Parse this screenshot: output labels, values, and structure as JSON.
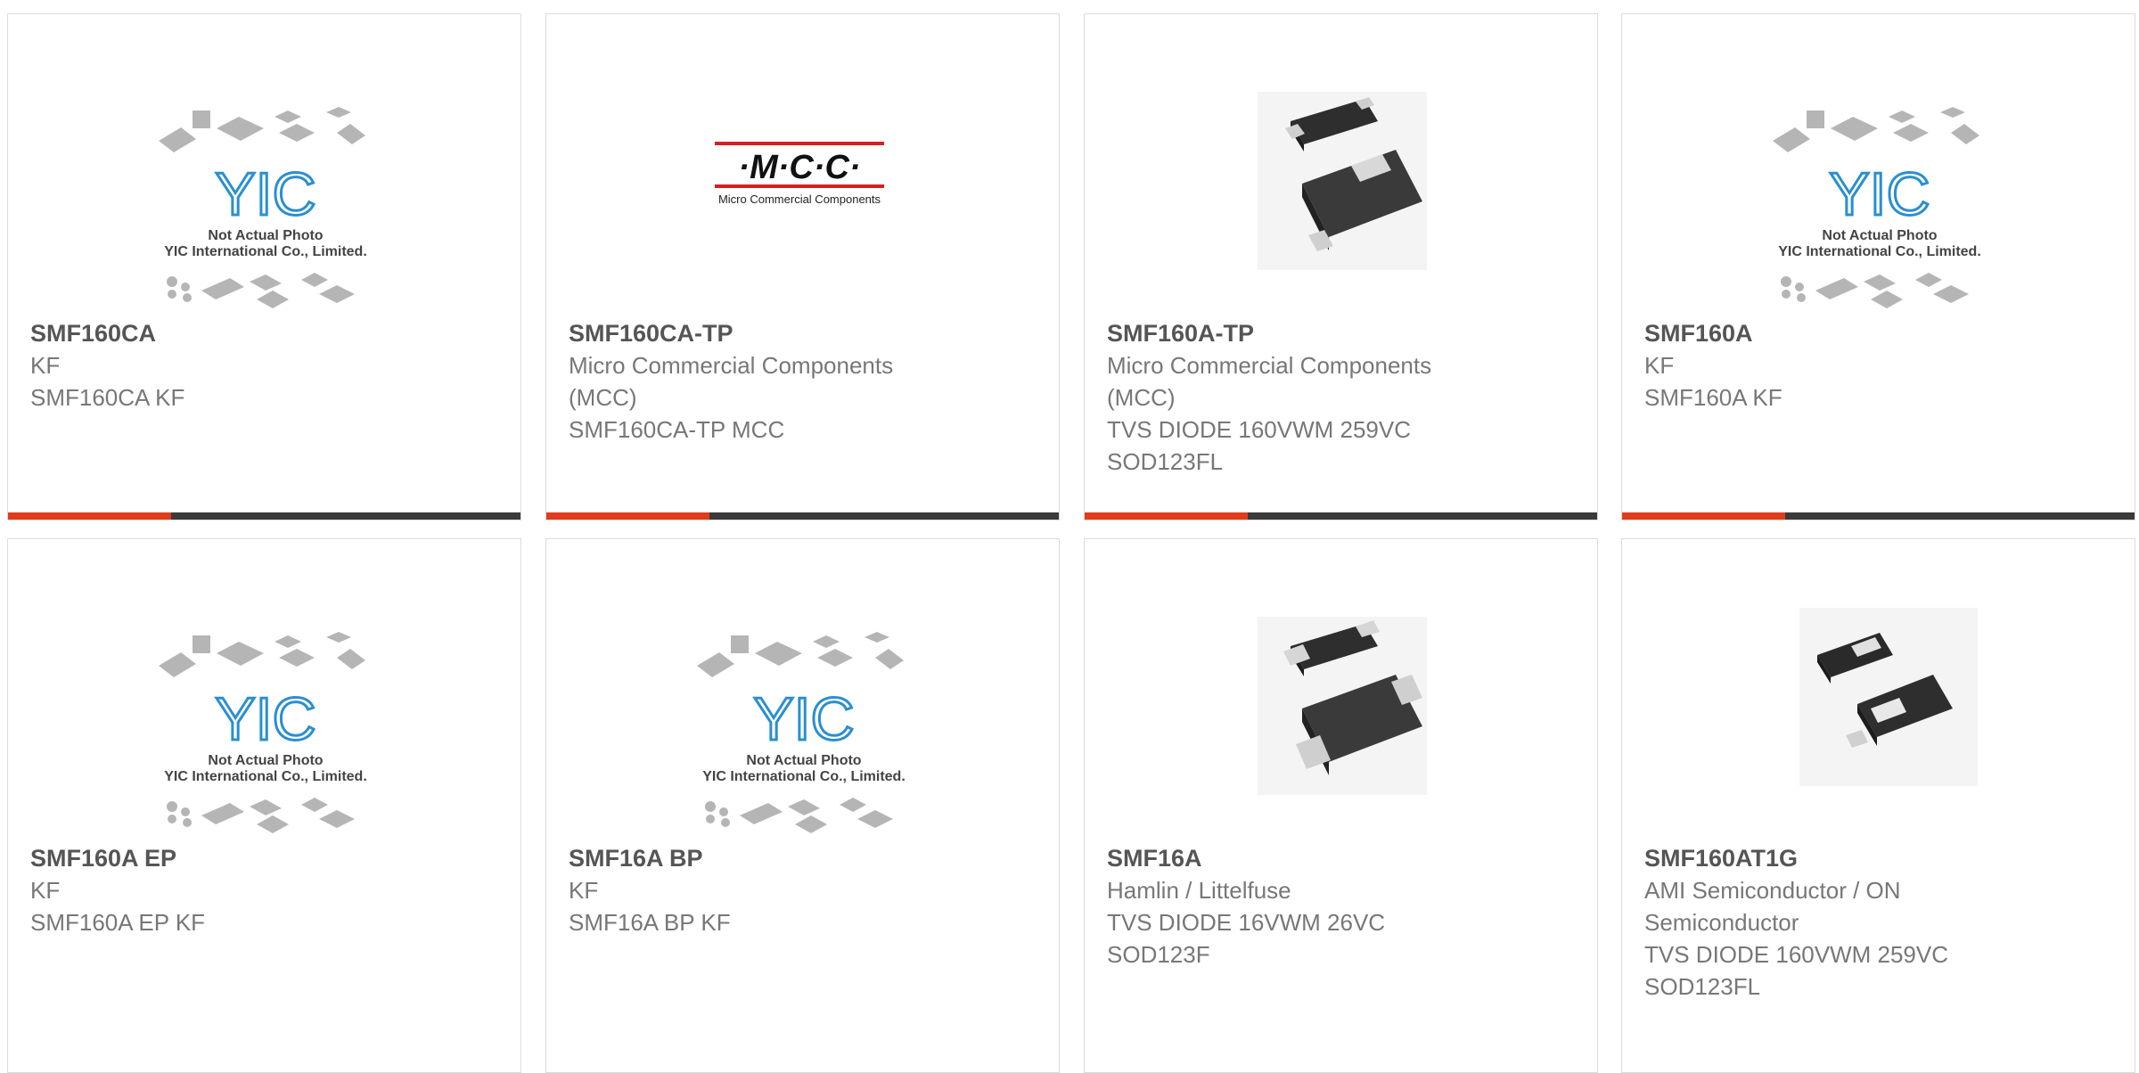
{
  "products": [
    {
      "part": "SMF160CA",
      "lines": [
        "KF",
        "SMF160CA KF"
      ],
      "image": "yic-placeholder-icon"
    },
    {
      "part": "SMF160CA-TP",
      "lines": [
        "Micro Commercial Components",
        "(MCC)",
        "SMF160CA-TP MCC"
      ],
      "image": "mcc-logo"
    },
    {
      "part": "SMF160A-TP",
      "lines": [
        "Micro Commercial Components",
        "(MCC)",
        "TVS DIODE 160VWM 259VC",
        "SOD123FL"
      ],
      "image": "diode-package-icon"
    },
    {
      "part": "SMF160A",
      "lines": [
        "KF",
        "SMF160A KF"
      ],
      "image": "yic-placeholder-icon"
    },
    {
      "part": "SMF160A EP",
      "lines": [
        "KF",
        "SMF160A EP KF"
      ],
      "image": "yic-placeholder-icon"
    },
    {
      "part": "SMF16A BP",
      "lines": [
        "KF",
        "SMF16A BP KF"
      ],
      "image": "yic-placeholder-icon"
    },
    {
      "part": "SMF16A",
      "lines": [
        "Hamlin / Littelfuse",
        "TVS DIODE 16VWM 26VC",
        "SOD123F"
      ],
      "image": "diode-package-icon"
    },
    {
      "part": "SMF160AT1G",
      "lines": [
        "AMI Semiconductor / ON",
        "Semiconductor",
        "TVS DIODE 160VWM 259VC",
        "SOD123FL"
      ],
      "image": "diode-package-icon"
    }
  ],
  "placeholder": {
    "brand": "YIC",
    "line1": "Not Actual Photo",
    "line2": "YIC International Co., Limited."
  },
  "mcc": {
    "logo_text": "·M·C·C·",
    "tagline": "Micro Commercial Components"
  },
  "colors": {
    "accent": "#e03c1b",
    "bar": "#3a3a3a",
    "yic_blue": "#2a8fd0"
  }
}
